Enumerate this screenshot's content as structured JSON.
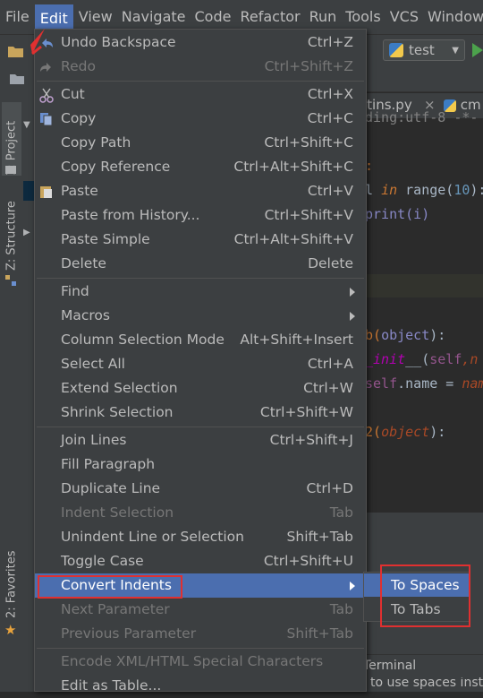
{
  "menubar": {
    "items": [
      "File",
      "Edit",
      "View",
      "Navigate",
      "Code",
      "Refactor",
      "Run",
      "Tools",
      "VCS",
      "Window"
    ],
    "active": "Edit"
  },
  "toolbar": {
    "run_config": "test"
  },
  "side_tabs": {
    "project": "1: Project",
    "structure": "Z: Structure",
    "favorites": "2: Favorites"
  },
  "editor": {
    "tabs": [
      "ltins.py",
      "cm"
    ],
    "lines": [
      {
        "text": "ding:utf-8 -*-",
        "kind": "comment"
      },
      {
        "text": ":",
        "kind": "plain"
      },
      {
        "pre": "l ",
        "kw": "in",
        "fn": " range(",
        "num": "10",
        "post": "):"
      },
      {
        "text": "print(i)",
        "kind": "builtin"
      },
      {
        "pre": "b(",
        "obj": "object",
        "post": "):"
      },
      {
        "pre": "_",
        "init": "init",
        "post": "__(",
        "self": "self",
        "rest": ",n"
      },
      {
        "self": "self",
        "rest": ".name = ",
        "pm": "nam"
      },
      {
        "pre": "2(",
        "obj": "object",
        "post": "):"
      }
    ]
  },
  "edit_menu": {
    "groups": [
      [
        {
          "label": "Undo Backspace",
          "shortcut": "Ctrl+Z",
          "icon": "undo-icon",
          "disabled": false
        },
        {
          "label": "Redo",
          "shortcut": "Ctrl+Shift+Z",
          "icon": "redo-icon",
          "disabled": true
        }
      ],
      [
        {
          "label": "Cut",
          "shortcut": "Ctrl+X",
          "icon": "scissors-icon",
          "disabled": false
        },
        {
          "label": "Copy",
          "shortcut": "Ctrl+C",
          "icon": "copy-icon",
          "disabled": false
        },
        {
          "label": "Copy Path",
          "shortcut": "Ctrl+Shift+C",
          "icon": "",
          "disabled": false
        },
        {
          "label": "Copy Reference",
          "shortcut": "Ctrl+Alt+Shift+C",
          "icon": "",
          "disabled": false
        },
        {
          "label": "Paste",
          "shortcut": "Ctrl+V",
          "icon": "paste-icon",
          "disabled": false
        },
        {
          "label": "Paste from History...",
          "shortcut": "Ctrl+Shift+V",
          "icon": "",
          "disabled": false
        },
        {
          "label": "Paste Simple",
          "shortcut": "Ctrl+Alt+Shift+V",
          "icon": "",
          "disabled": false
        },
        {
          "label": "Delete",
          "shortcut": "Delete",
          "icon": "",
          "disabled": false
        }
      ],
      [
        {
          "label": "Find",
          "shortcut": "",
          "submenu": true,
          "disabled": false
        },
        {
          "label": "Macros",
          "shortcut": "",
          "submenu": true,
          "disabled": false
        },
        {
          "label": "Column Selection Mode",
          "shortcut": "Alt+Shift+Insert",
          "disabled": false
        },
        {
          "label": "Select All",
          "shortcut": "Ctrl+A",
          "disabled": false
        },
        {
          "label": "Extend Selection",
          "shortcut": "Ctrl+W",
          "disabled": false
        },
        {
          "label": "Shrink Selection",
          "shortcut": "Ctrl+Shift+W",
          "disabled": false
        }
      ],
      [
        {
          "label": "Join Lines",
          "shortcut": "Ctrl+Shift+J",
          "disabled": false
        },
        {
          "label": "Fill Paragraph",
          "shortcut": "",
          "disabled": false
        },
        {
          "label": "Duplicate Line",
          "shortcut": "Ctrl+D",
          "disabled": false
        },
        {
          "label": "Indent Selection",
          "shortcut": "Tab",
          "disabled": true
        },
        {
          "label": "Unindent Line or Selection",
          "shortcut": "Shift+Tab",
          "disabled": false
        },
        {
          "label": "Toggle Case",
          "shortcut": "Ctrl+Shift+U",
          "disabled": false
        },
        {
          "label": "Convert Indents",
          "shortcut": "",
          "submenu": true,
          "selected": true,
          "disabled": false
        },
        {
          "label": "Next Parameter",
          "shortcut": "Tab",
          "disabled": true
        },
        {
          "label": "Previous Parameter",
          "shortcut": "Shift+Tab",
          "disabled": true
        }
      ],
      [
        {
          "label": "Encode XML/HTML Special Characters",
          "shortcut": "",
          "disabled": true
        },
        {
          "label": "Edit as Table...",
          "shortcut": "",
          "disabled": false
        }
      ]
    ]
  },
  "convert_indents_submenu": {
    "items": [
      {
        "label": "To Spaces",
        "selected": true
      },
      {
        "label": "To Tabs",
        "selected": false
      }
    ]
  },
  "bottom": {
    "terminal": "Terminal",
    "status": "to use spaces inst"
  },
  "colors": {
    "menu_bg": "#3c3f41",
    "selection": "#4b6eaf",
    "annotation_red": "#e03030"
  }
}
